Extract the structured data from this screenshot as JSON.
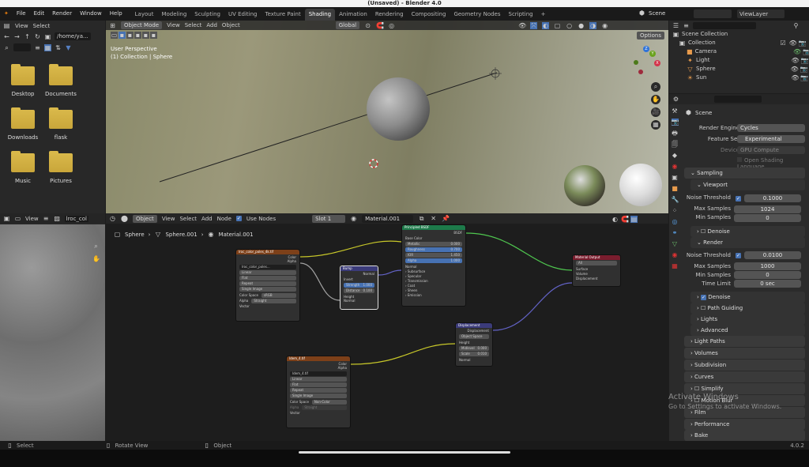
{
  "window_title": "(Unsaved) - Blender 4.0",
  "menus": [
    "File",
    "Edit",
    "Render",
    "Window",
    "Help"
  ],
  "workspaces": [
    "Layout",
    "Modeling",
    "Sculpting",
    "UV Editing",
    "Texture Paint",
    "Shading",
    "Animation",
    "Rendering",
    "Compositing",
    "Geometry Nodes",
    "Scripting",
    "+"
  ],
  "scene_label": "Scene",
  "viewlayer_label": "ViewLayer",
  "filebrowser": {
    "menu_view": "View",
    "menu_select": "Select",
    "path": "/home/ya...",
    "folders": [
      "Desktop",
      "Documents",
      "Downloads",
      "flask",
      "Music",
      "Pictures"
    ]
  },
  "imageeditor": {
    "view": "View",
    "image_name": "lroc_col"
  },
  "viewport": {
    "mode": "Object Mode",
    "view": "View",
    "select": "Select",
    "add": "Add",
    "object": "Object",
    "orientation": "Global",
    "options": "Options",
    "info1": "User Perspective",
    "info2": "(1) Collection | Sphere",
    "axis_x": "X",
    "axis_y": "Y",
    "axis_z": "Z"
  },
  "outliner": {
    "items": [
      "Scene Collection",
      "Collection",
      "Camera",
      "Light",
      "Sphere",
      "Sun"
    ]
  },
  "node_editor": {
    "object": "Object",
    "view": "View",
    "select": "Select",
    "add": "Add",
    "node": "Node",
    "use_nodes": "Use Nodes",
    "slot": "Slot 1",
    "material": "Material.001",
    "breadcrumb": [
      "Sphere",
      "Sphere.001",
      "Material.001"
    ]
  },
  "nodes": {
    "img1": {
      "title": "lroc_color_poles_4k.tif",
      "out_color": "Color",
      "out_alpha": "Alpha",
      "name": "lroc_color_poles...",
      "interp": "Linear",
      "proj": "Flat",
      "ext": "Repeat",
      "src": "Single Image",
      "cs_label": "Color Space",
      "cs": "sRGB",
      "alpha_label": "Alpha",
      "alpha": "Straight",
      "vector": "Vector"
    },
    "bump": {
      "title": "Bump",
      "normal_out": "Normal",
      "invert": "Invert",
      "strength": "Strength",
      "strength_val": "1.000",
      "distance": "Distance",
      "distance_val": "0.100",
      "height": "Height",
      "normal": "Normal"
    },
    "bsdf": {
      "title": "Principled BSDF",
      "bsdf": "BSDF",
      "base_color": "Base Color",
      "metallic": "Metallic",
      "metallic_val": "0.000",
      "roughness": "Roughness",
      "roughness_val": "0.700",
      "ior": "IOR",
      "ior_val": "1.450",
      "alpha": "Alpha",
      "alpha_val": "1.000",
      "normal": "Normal",
      "subs": [
        "Subsurface",
        "Specular",
        "Transmission",
        "Coat",
        "Sheen",
        "Emission"
      ]
    },
    "out": {
      "title": "Material Output",
      "target": "All",
      "surface": "Surface",
      "volume": "Volume",
      "displacement": "Displacement"
    },
    "disp": {
      "title": "Displacement",
      "out": "Displacement",
      "space": "Object Space",
      "height": "Height",
      "midlevel": "Midlevel",
      "midlevel_val": "0.000",
      "scale": "Scale",
      "scale_val": "0.010",
      "normal": "Normal"
    },
    "img2": {
      "title": "ldem_4.tif",
      "out_color": "Color",
      "out_alpha": "Alpha",
      "name": "ldem_4.tif",
      "interp": "Linear",
      "proj": "Flat",
      "ext": "Repeat",
      "src": "Single Image",
      "cs_label": "Color Space",
      "cs": "Non-Color",
      "alpha_label": "Alpha",
      "alpha": "Straight",
      "vector": "Vector"
    }
  },
  "properties": {
    "scene": "Scene",
    "render_engine_label": "Render Engine",
    "render_engine": "Cycles",
    "feature_set_label": "Feature Set",
    "feature_set": "Experimental",
    "device_label": "Device",
    "device": "GPU Compute",
    "osl": "Open Shading Language",
    "sampling": "Sampling",
    "viewport": "Viewport",
    "noise_threshold_label": "Noise Threshold",
    "vp_noise": "0.1000",
    "max_samples_label": "Max Samples",
    "vp_max": "1024",
    "min_samples_label": "Min Samples",
    "vp_min": "0",
    "denoise": "Denoise",
    "render": "Render",
    "r_noise": "0.0100",
    "r_max": "1000",
    "r_min": "0",
    "time_limit_label": "Time Limit",
    "r_time": "0 sec",
    "path_guiding": "Path Guiding",
    "lights": "Lights",
    "advanced": "Advanced",
    "sections": [
      "Light Paths",
      "Volumes",
      "Subdivision",
      "Curves",
      "Simplify",
      "Motion Blur",
      "Film",
      "Performance",
      "Bake"
    ]
  },
  "statusbar": {
    "select": "Select",
    "rotate": "Rotate View",
    "object": "Object",
    "version": "4.0.2"
  },
  "watermark": {
    "line1": "Activate Windows",
    "line2": "Go to Settings to activate Windows."
  }
}
